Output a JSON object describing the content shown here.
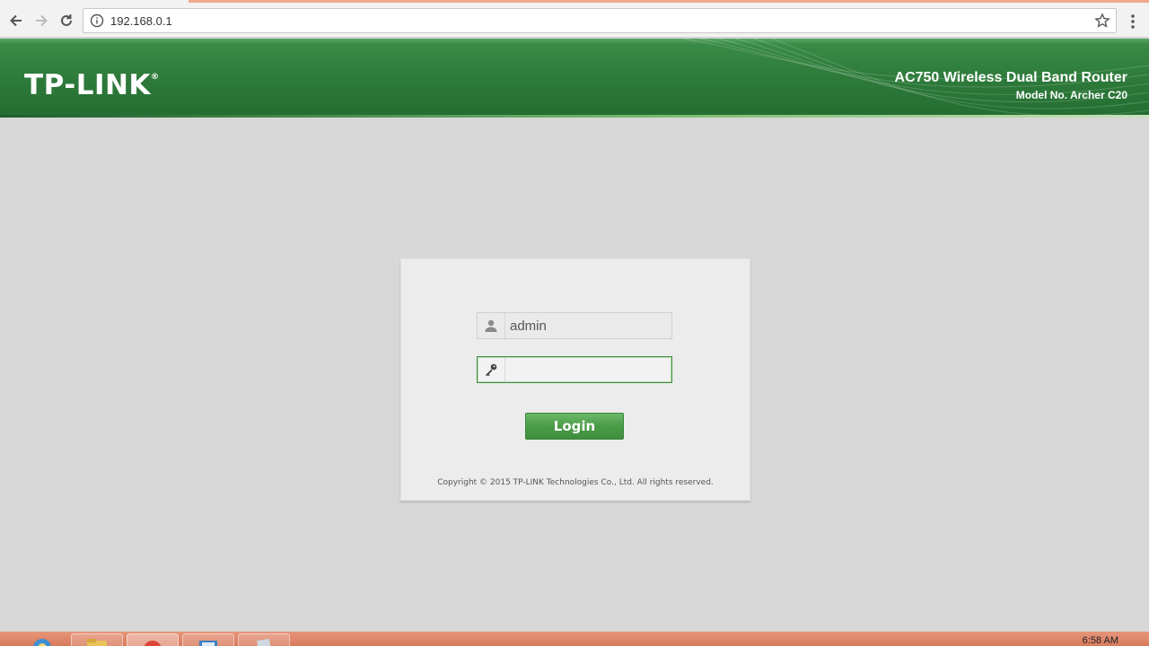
{
  "browser": {
    "url": "192.168.0.1",
    "icons": [
      "back-arrow-icon",
      "forward-arrow-icon",
      "reload-icon",
      "info-icon",
      "star-icon",
      "menu-dots-icon"
    ]
  },
  "header": {
    "logo": "TP-LINK",
    "logo_mark": "®",
    "product": "AC750 Wireless Dual Band Router",
    "model": "Model No. Archer C20",
    "colors": {
      "banner": "#2f7c3c"
    }
  },
  "login": {
    "username_value": "admin",
    "password_value": "",
    "button_label": "Login",
    "copyright": "Copyright © 2015 TP-LINK Technologies Co., Ltd. All rights reserved.",
    "icons": [
      "user-icon",
      "key-icon"
    ],
    "colors": {
      "button": "#4a9c48",
      "focus_border": "#3f8f3f"
    }
  },
  "taskbar": {
    "clock": "6:58 AM",
    "items": [
      "internet-explorer-icon",
      "file-explorer-icon",
      "chrome-icon",
      "screen-capture-icon",
      "notepad-icon"
    ],
    "colors": {
      "bar": "#d97a5c"
    }
  }
}
